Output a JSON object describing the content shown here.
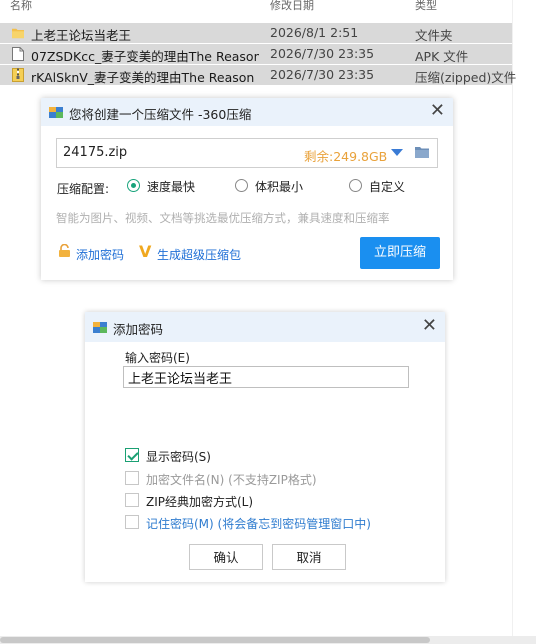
{
  "columns": {
    "name": "名称",
    "date": "修改日期",
    "type": "类型"
  },
  "files": [
    {
      "name": "上老王论坛当老王",
      "date": "2026/8/1 2:51",
      "type": "文件夹",
      "icon": "folder-icon"
    },
    {
      "name": "07ZSDKcc_妻子变美的理由The Reason...",
      "date": "2026/7/30 23:35",
      "type": "APK 文件",
      "icon": "file-icon"
    },
    {
      "name": "rKAlSknV_妻子变美的理由The Reason ...",
      "date": "2026/7/30 23:35",
      "type": "压缩(zipped)文件",
      "icon": "zip-icon"
    }
  ],
  "compress_dialog": {
    "title": "您将创建一个压缩文件 -360压缩",
    "close": "✕",
    "filename": "24175.zip",
    "free_space": "剩余:249.8GB",
    "config_label": "压缩配置:",
    "options": [
      {
        "label": "速度最快",
        "selected": true
      },
      {
        "label": "体积最小",
        "selected": false
      },
      {
        "label": "自定义",
        "selected": false
      }
    ],
    "hint": "智能为图片、视频、文档等挑选最优压缩方式，兼具速度和压缩率",
    "add_password": "添加密码",
    "super_pack": "生成超级压缩包",
    "compress_button": "立即压缩",
    "accent": "#1a8ff0"
  },
  "password_dialog": {
    "title": "添加密码",
    "close": "✕",
    "input_label": "输入密码(E)",
    "password": "上老王论坛当老王",
    "checkboxes": [
      {
        "label": "显示密码(S)",
        "checked": true
      },
      {
        "label": "加密文件名(N) (不支持ZIP格式)",
        "checked": false
      },
      {
        "label": "ZIP经典加密方式(L)",
        "checked": false
      },
      {
        "label": "记住密码(M) (将会备忘到密码管理窗口中)",
        "checked": false
      }
    ],
    "ok": "确认",
    "cancel": "取消"
  }
}
